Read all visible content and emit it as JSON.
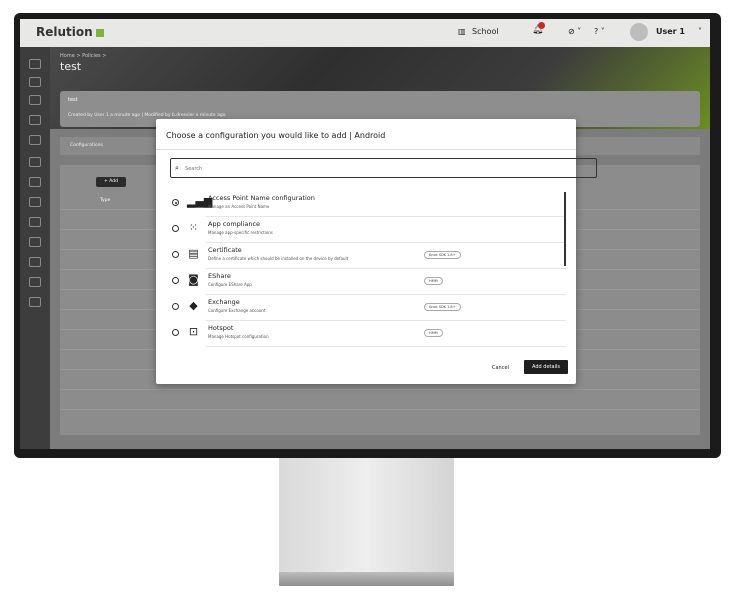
{
  "app": {
    "brand": "Relution",
    "brand_color": "#7cb342"
  },
  "topbar": {
    "org": "School",
    "notifications_count": "1",
    "user": "User 1"
  },
  "page": {
    "breadcrumb": "Home > Policies >",
    "title": "test",
    "card": {
      "name": "test",
      "meta": "Created by  User 1  a minute ago  |  Modified by b.dressler a minute ago"
    },
    "tab": "Configurations",
    "add_button": "+ Add",
    "type_col": "Type"
  },
  "dialog": {
    "title": "Choose a configuration you would like to add | Android",
    "search_placeholder": "Search",
    "options": [
      {
        "name": "Access Point Name configuration",
        "desc": "Manage an Access Point Name",
        "badge": "",
        "icon": "signal-bars-icon",
        "selected": true
      },
      {
        "name": "App compliance",
        "desc": "Manage app-specific restrictions",
        "badge": "",
        "icon": "app-grid-icon",
        "selected": false
      },
      {
        "name": "Certificate",
        "desc": "Define a certificate which should be installed on the device by default",
        "badge": "Knox SDK 1.8+",
        "icon": "certificate-icon",
        "selected": false
      },
      {
        "name": "EShare",
        "desc": "Configure EShare App",
        "badge": "HMM",
        "icon": "eshare-icon",
        "selected": false
      },
      {
        "name": "Exchange",
        "desc": "Configure Exchange account",
        "badge": "Knox SDK 1.8+",
        "icon": "exchange-icon",
        "selected": false
      },
      {
        "name": "Hotspot",
        "desc": "Manage Hotspot configuration",
        "badge": "HMM",
        "icon": "hotspot-icon",
        "selected": false
      }
    ],
    "cancel": "Cancel",
    "add_details": "Add details"
  }
}
